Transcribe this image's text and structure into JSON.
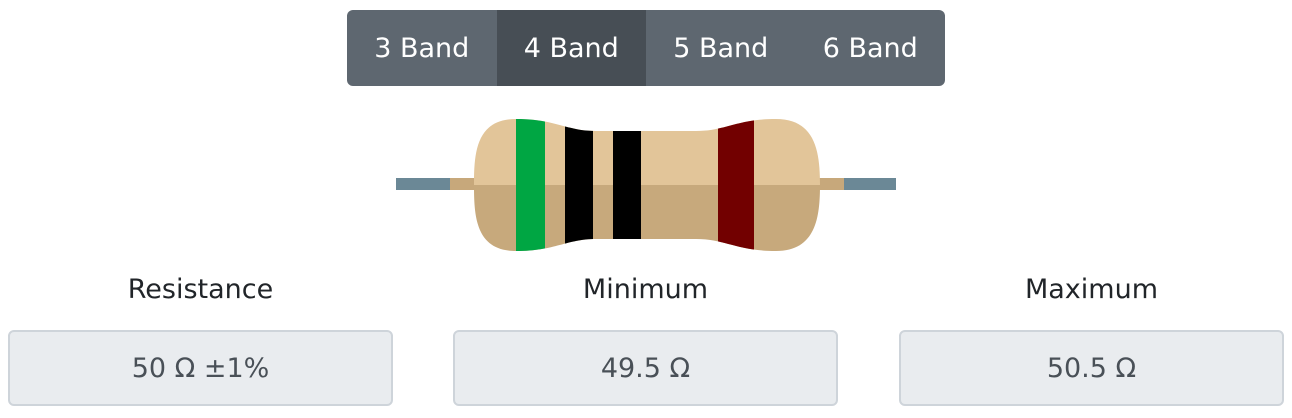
{
  "band_selector": {
    "tabs": [
      {
        "label": "3 Band",
        "active": false
      },
      {
        "label": "4 Band",
        "active": true
      },
      {
        "label": "5 Band",
        "active": false
      },
      {
        "label": "6 Band",
        "active": false
      }
    ]
  },
  "resistor": {
    "body_color": "#e2c599",
    "lead_color": "#6b8896",
    "bands": [
      {
        "name": "green",
        "color": "#00a643"
      },
      {
        "name": "black",
        "color": "#000000"
      },
      {
        "name": "black",
        "color": "#000000"
      },
      {
        "name": "brown-red",
        "color": "#720000"
      }
    ]
  },
  "results": {
    "resistance": {
      "label": "Resistance",
      "value": "50 Ω ±1%"
    },
    "minimum": {
      "label": "Minimum",
      "value": "49.5 Ω"
    },
    "maximum": {
      "label": "Maximum",
      "value": "50.5 Ω"
    }
  }
}
